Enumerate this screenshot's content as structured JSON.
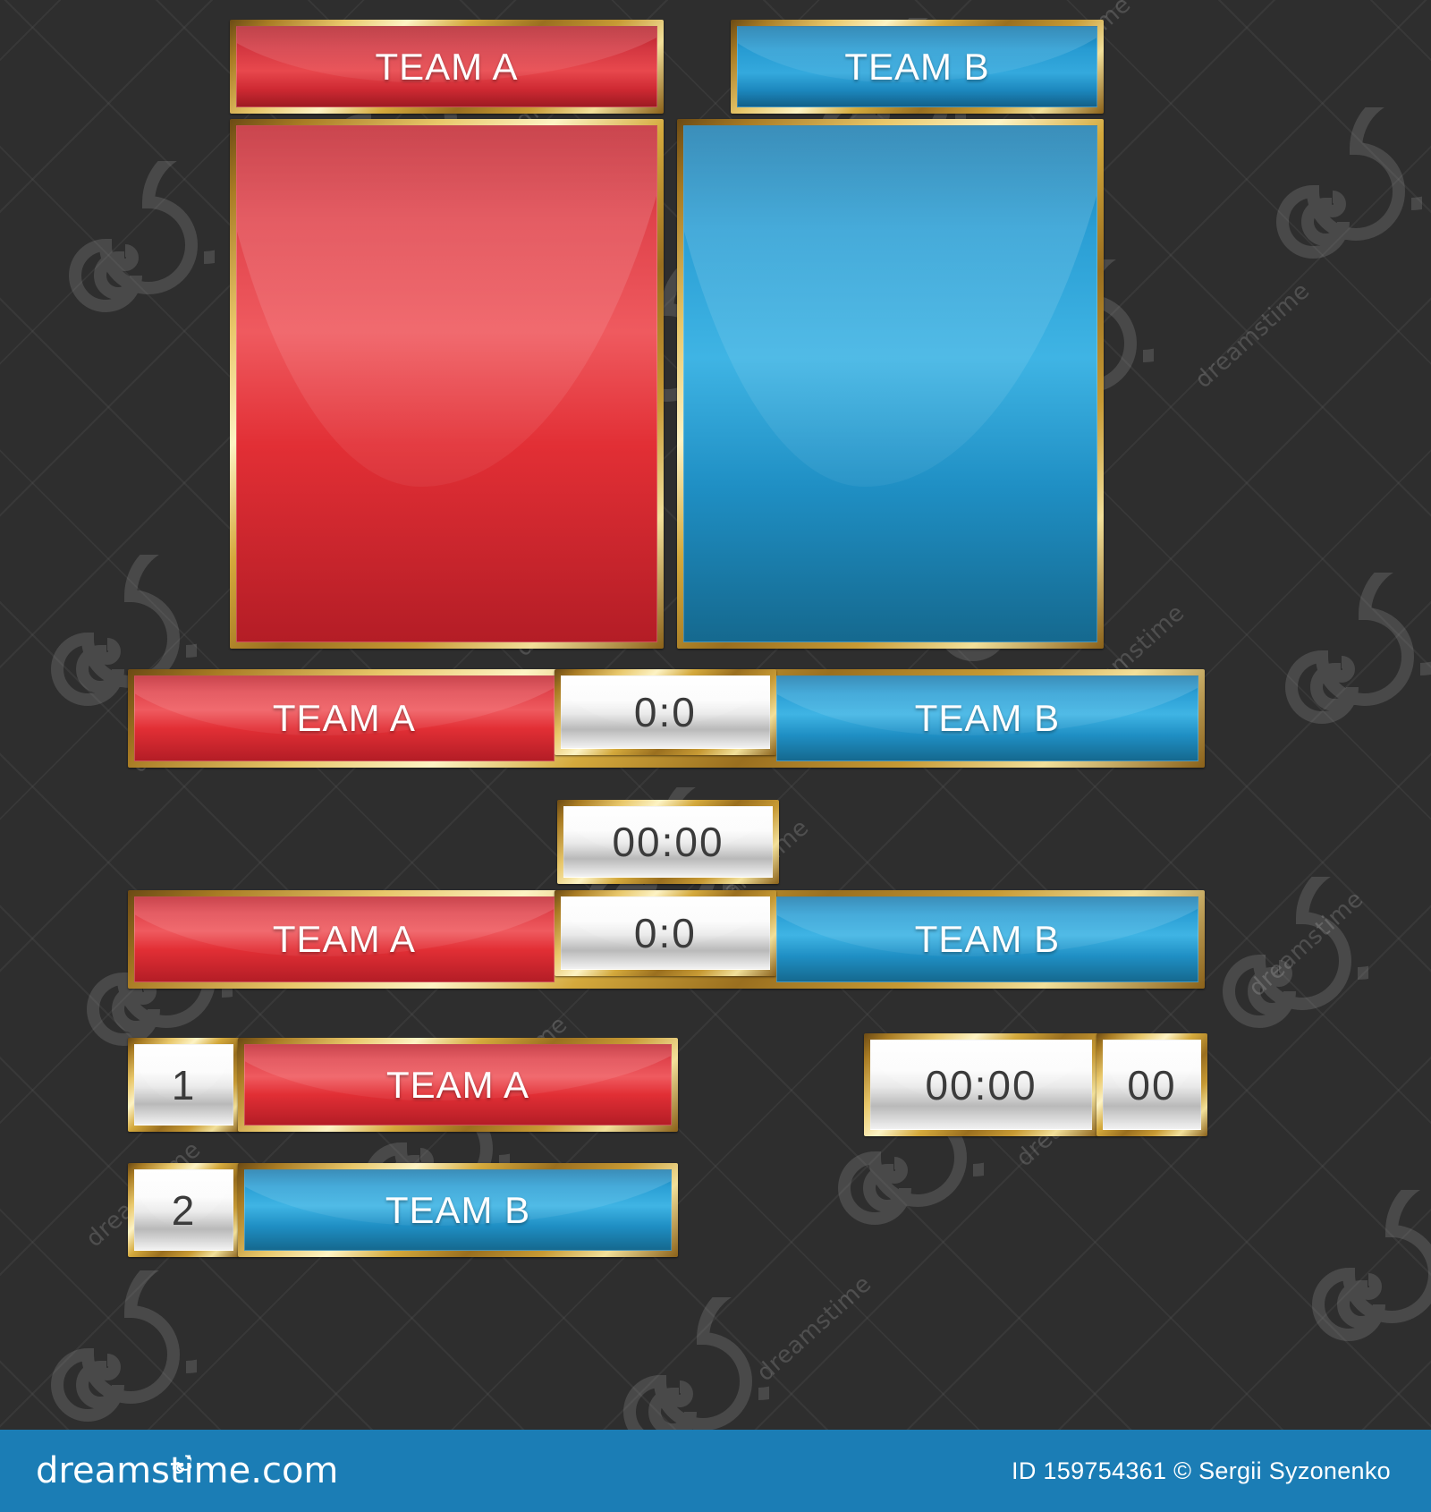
{
  "background_color": "#2e2e2e",
  "colors": {
    "red": "#e0434b",
    "blue": "#2a9ed4",
    "gold": "#d4a93c",
    "silver": "#e9e9e9",
    "footer_blue": "#1b7db5",
    "text_light": "#ffffff",
    "text_dark": "#3b3b3b"
  },
  "panels": {
    "team_a_header": "TEAM A",
    "team_b_header": "TEAM B"
  },
  "scoreboard_1": {
    "team_a": "TEAM A",
    "score": "0:0",
    "team_b": "TEAM B"
  },
  "timer_standalone": {
    "value": "00:00"
  },
  "scoreboard_2": {
    "team_a": "TEAM A",
    "score": "0:0",
    "team_b": "TEAM B"
  },
  "ranked_rows": [
    {
      "rank": "1",
      "team": "TEAM A",
      "color": "red"
    },
    {
      "rank": "2",
      "team": "TEAM B",
      "color": "blue"
    }
  ],
  "timer_panel": {
    "clock": "00:00",
    "seconds": "00"
  },
  "footer": {
    "site": "dreamstime.com",
    "credit": "ID 159754361 © Sergii Syzonenko"
  },
  "watermark": {
    "text": "dreamstime"
  }
}
